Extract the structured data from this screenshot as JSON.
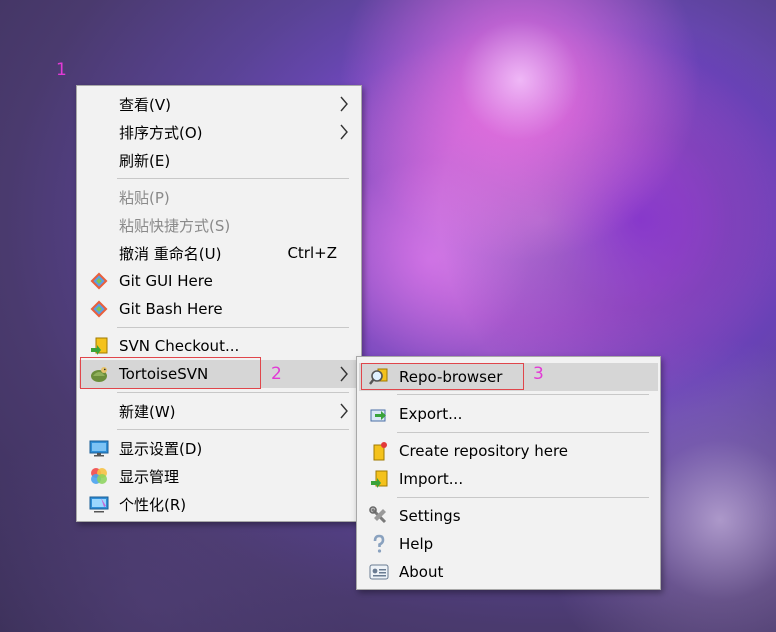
{
  "markers": {
    "one": "1",
    "two": "2",
    "three": "3"
  },
  "context_menu": {
    "items": [
      {
        "label": "查看(V)"
      },
      {
        "label": "排序方式(O)"
      },
      {
        "label": "刷新(E)"
      },
      {
        "label": "粘贴(P)"
      },
      {
        "label": "粘贴快捷方式(S)"
      },
      {
        "label": "撤消 重命名(U)",
        "shortcut": "Ctrl+Z"
      },
      {
        "label": "Git GUI Here",
        "icon": "git-gui-icon"
      },
      {
        "label": "Git Bash Here",
        "icon": "git-bash-icon"
      },
      {
        "label": "SVN Checkout...",
        "icon": "svn-checkout-icon"
      },
      {
        "label": "TortoiseSVN",
        "icon": "tortoisesvn-icon"
      },
      {
        "label": "新建(W)"
      },
      {
        "label": "显示设置(D)",
        "icon": "display-settings-icon"
      },
      {
        "label": "显示管理",
        "icon": "display-manage-icon"
      },
      {
        "label": "个性化(R)",
        "icon": "personalize-icon"
      }
    ]
  },
  "submenu": {
    "items": [
      {
        "label": "Repo-browser",
        "icon": "repo-browser-icon"
      },
      {
        "label": "Export...",
        "icon": "export-icon"
      },
      {
        "label": "Create repository here",
        "icon": "create-repository-icon"
      },
      {
        "label": "Import...",
        "icon": "import-icon"
      },
      {
        "label": "Settings",
        "icon": "settings-icon"
      },
      {
        "label": "Help",
        "icon": "help-icon"
      },
      {
        "label": "About",
        "icon": "about-icon"
      }
    ]
  },
  "colors": {
    "menu_bg": "#f2f2f2",
    "highlight": "#d6d6d6",
    "annotation": "#e23ad6",
    "annotation_box": "#e0464b"
  }
}
